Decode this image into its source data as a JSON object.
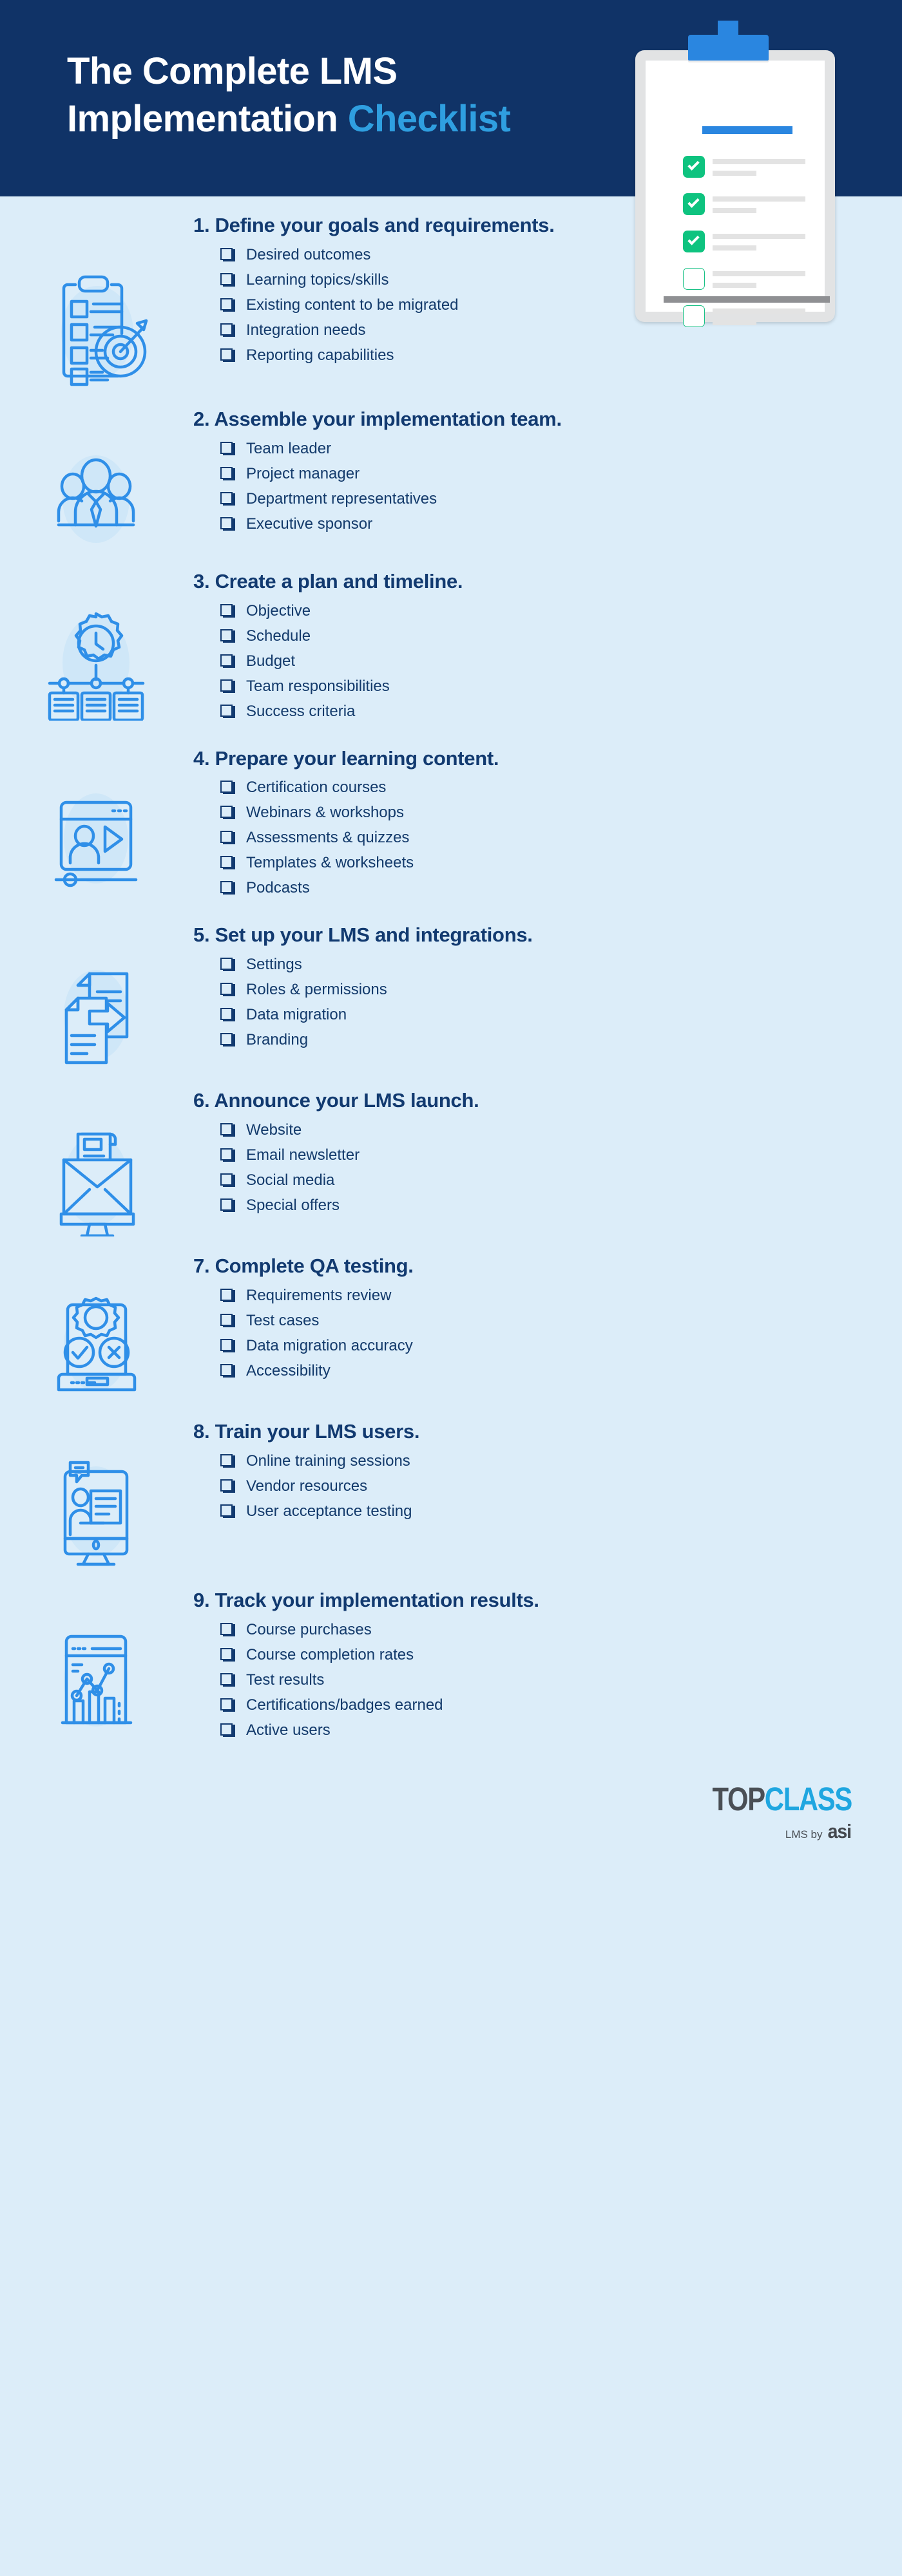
{
  "header": {
    "title_line1": "The Complete LMS",
    "title_line2_plain": "Implementation ",
    "title_accent": "Checklist",
    "navy": "#103367",
    "accent_blue": "#2f9fe0"
  },
  "clipboard": {
    "icon": "clipboard-illustration",
    "checked_count": 3,
    "unchecked_count": 2,
    "check_color": "#0ec37f",
    "clip_color": "#2a86e0"
  },
  "theme": {
    "background": "#dcedf9",
    "heading_color": "#123a70",
    "list_text_color": "#133a6b",
    "icon_stroke": "#2f8fe8",
    "icon_halo": "#cfe7f8"
  },
  "sections": [
    {
      "number": "1.",
      "heading": "1. Define your goals and requirements.",
      "icon": "clipboard-target-icon",
      "items": [
        "Desired outcomes",
        "Learning topics/skills",
        "Existing content to be migrated",
        "Integration needs",
        "Reporting capabilities"
      ]
    },
    {
      "number": "2.",
      "heading": "2. Assemble your implementation team.",
      "icon": "team-people-icon",
      "items": [
        "Team leader",
        "Project manager",
        "Department representatives",
        "Executive sponsor"
      ]
    },
    {
      "number": "3.",
      "heading": "3. Create a plan and timeline.",
      "icon": "clock-gear-timeline-icon",
      "items": [
        "Objective",
        "Schedule",
        "Budget",
        "Team responsibilities",
        "Success criteria"
      ]
    },
    {
      "number": "4.",
      "heading": "4. Prepare your learning content.",
      "icon": "video-player-icon",
      "items": [
        "Certification courses",
        "Webinars & workshops",
        "Assessments & quizzes",
        "Templates & worksheets",
        "Podcasts"
      ]
    },
    {
      "number": "5.",
      "heading": "5. Set up your LMS and integrations.",
      "icon": "document-transfer-icon",
      "items": [
        "Settings",
        "Roles & permissions",
        "Data migration",
        "Branding"
      ]
    },
    {
      "number": "6.",
      "heading": "6. Announce your LMS launch.",
      "icon": "email-newsletter-icon",
      "items": [
        "Website",
        "Email newsletter",
        "Social media",
        "Special offers"
      ]
    },
    {
      "number": "7.",
      "heading": "7. Complete QA testing.",
      "icon": "qa-gear-check-cross-icon",
      "items": [
        "Requirements review",
        "Test cases",
        "Data migration accuracy",
        "Accessibility"
      ]
    },
    {
      "number": "8.",
      "heading": "8. Train your LMS users.",
      "icon": "training-monitor-icon",
      "items": [
        "Online training sessions",
        "Vendor resources",
        "User acceptance testing"
      ]
    },
    {
      "number": "9.",
      "heading": "9. Track your implementation results.",
      "icon": "analytics-dashboard-icon",
      "items": [
        "Course purchases",
        "Course completion rates",
        "Test results",
        "Certifications/badges earned",
        "Active users"
      ]
    }
  ],
  "footer": {
    "logo_top": "TOP",
    "logo_class": "CLASS",
    "logo_sub_prefix": "LMS by",
    "logo_asi": "asi",
    "logo_top_color": "#4a4f55",
    "logo_class_color": "#1fa6e0"
  }
}
